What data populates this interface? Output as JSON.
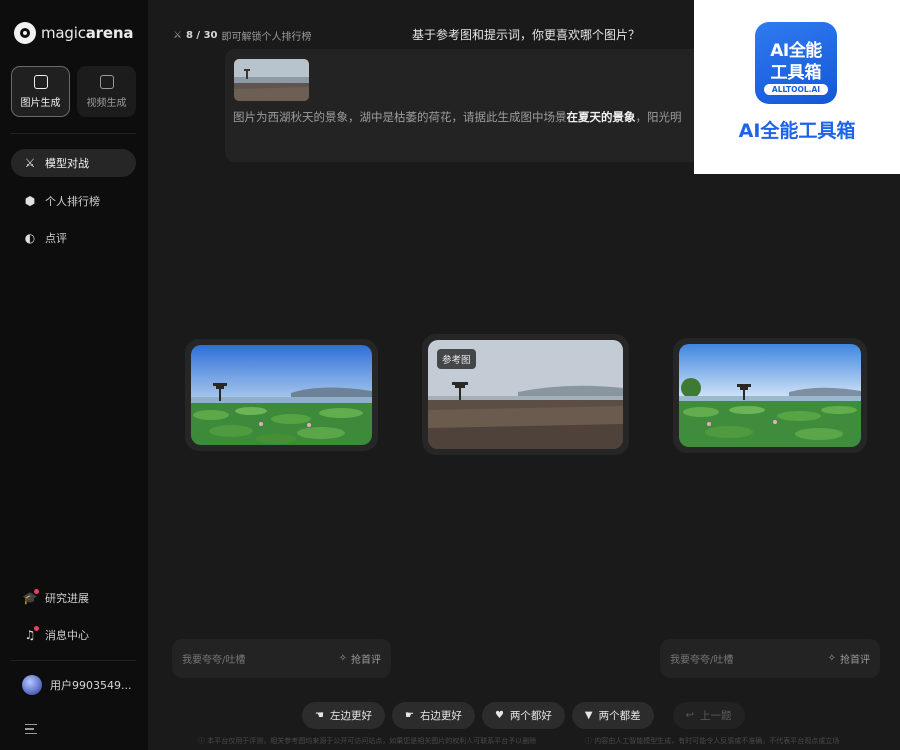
{
  "sidebar": {
    "logo_light": "magic",
    "logo_bold": "arena",
    "mode_tabs": [
      {
        "label": "图片生成",
        "icon": "image-icon",
        "active": true
      },
      {
        "label": "视频生成",
        "icon": "video-icon",
        "active": false
      }
    ],
    "nav_items": [
      {
        "label": "模型对战",
        "icon": "swords-icon",
        "active": true
      },
      {
        "label": "个人排行榜",
        "icon": "medal-icon",
        "active": false
      },
      {
        "label": "点评",
        "icon": "planet-icon",
        "active": false
      }
    ],
    "bottom_items": [
      {
        "label": "研究进展",
        "icon": "graduation-cap-icon",
        "badge": true
      },
      {
        "label": "消息中心",
        "icon": "bell-icon",
        "badge": true
      }
    ],
    "user": {
      "name": "用户9903549..."
    }
  },
  "header": {
    "progress_current": "8",
    "progress_sep": " / ",
    "progress_total": "30",
    "progress_hint": "即可解锁个人排行榜",
    "question": "基于参考图和提示词，你更喜欢哪个图片？"
  },
  "prompt": {
    "text_before": "图片为西湖秋天的景象，湖中是枯萎的荷花，请据此生成图中场景",
    "text_bold": "在夏天的景象",
    "text_after": "，阳光明"
  },
  "images": {
    "reference_tag": "参考图"
  },
  "comments": {
    "placeholder": "我要夸夸/吐槽",
    "grab_label": "抢首评"
  },
  "votes": {
    "left_better": "左边更好",
    "right_better": "右边更好",
    "both_good": "两个都好",
    "both_bad": "两个都差",
    "previous": "上一题"
  },
  "disclaimers": {
    "left": "本平台仅用于评测，相关参考图均来源于公开可访问站点，如果您是相关图片的权利人可联系平台予以删除",
    "right": "内容由人工智能模型生成，有时可能令人反感或不准确，不代表平台观点或立场"
  },
  "watermark": {
    "badge_line1": "AI全能",
    "badge_line2": "工具箱",
    "badge_domain": "ALLTOOL.AI",
    "title": "AI全能工具箱"
  },
  "colors": {
    "sidebar_bg": "#0d0d0d",
    "main_bg": "#1a1a1a",
    "accent_blue": "#1f63e6",
    "badge_red": "#e9435a"
  }
}
